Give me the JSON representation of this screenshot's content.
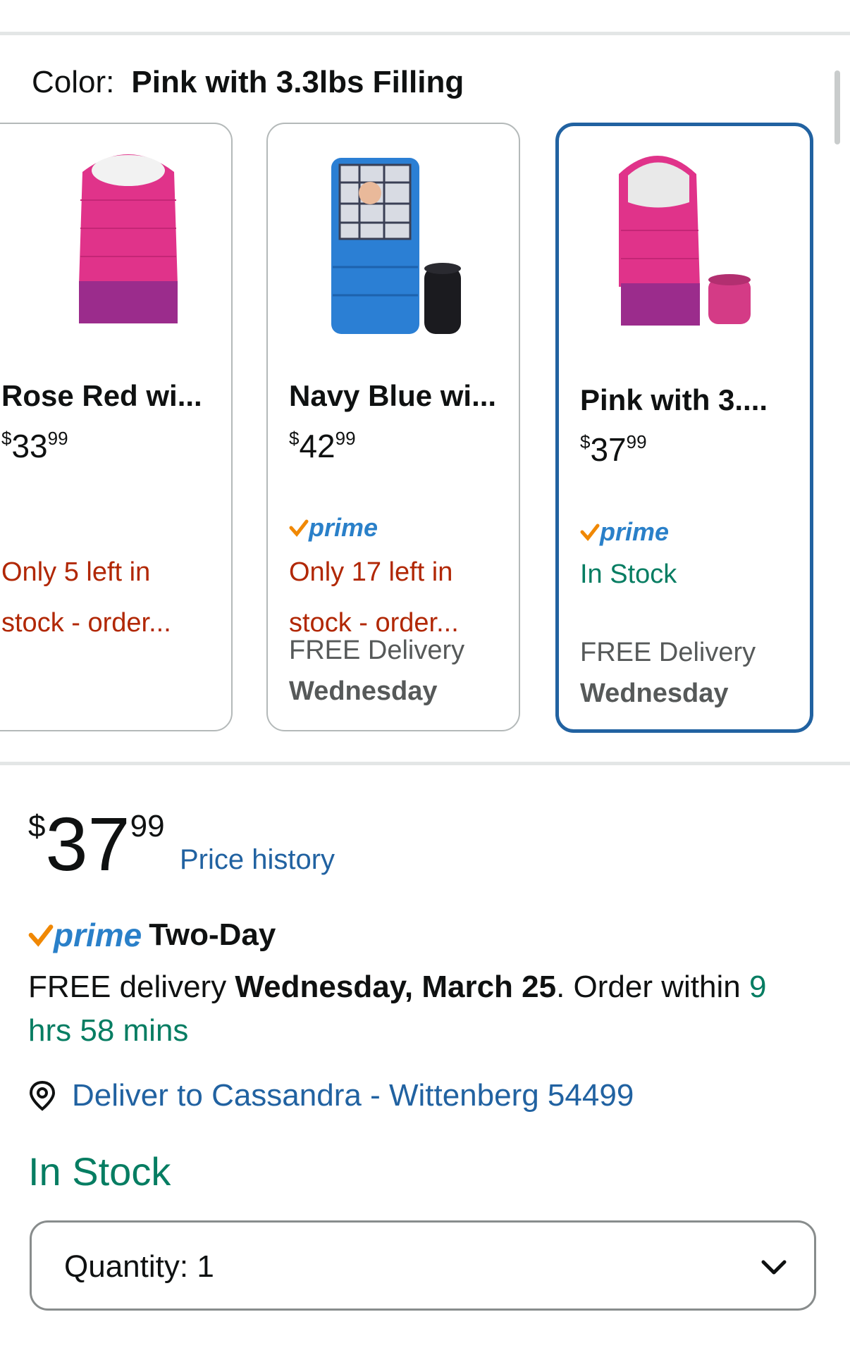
{
  "color": {
    "label": "Color:",
    "value": "Pink with 3.3lbs Filling"
  },
  "swatches": [
    {
      "name": "Rose Red wi...",
      "price_symbol": "$",
      "price_whole": "33",
      "price_fraction": "99",
      "stock_line1": "Only 5 left in",
      "stock_line2": "stock - order..."
    },
    {
      "name": "Navy Blue wi...",
      "price_symbol": "$",
      "price_whole": "42",
      "price_fraction": "99",
      "prime": "prime",
      "stock_line1": "Only 17 left in",
      "stock_line2": "stock - order...",
      "delivery": "FREE Delivery",
      "delivery_day": "Wednesday"
    },
    {
      "name": "Pink with 3....",
      "price_symbol": "$",
      "price_whole": "37",
      "price_fraction": "99",
      "prime": "prime",
      "stock": "In Stock",
      "delivery": "FREE Delivery",
      "delivery_day": "Wednesday",
      "selected": true
    }
  ],
  "buybox": {
    "price_symbol": "$",
    "price_whole": "37",
    "price_fraction": "99",
    "price_history": "Price history",
    "prime": "prime",
    "prime_service": "Two-Day",
    "delivery_prefix": "FREE delivery ",
    "delivery_date": "Wednesday, March 25",
    "delivery_middle": ". Order within ",
    "order_within": "9 hrs 58 mins",
    "deliver_to": "Deliver to Cassandra - Wittenberg 54499",
    "in_stock": "In Stock",
    "quantity_label": "Quantity:",
    "quantity_value": "1"
  },
  "colors": {
    "link": "#2162a1",
    "prime_blue": "#2a80c9",
    "prime_check": "#f08804",
    "stock_red": "#b12704",
    "stock_green": "#067d62",
    "selected_border": "#2162a1",
    "pink_bag": "#e0338a",
    "purple_bag": "#9b2c8c",
    "blue_bag": "#2b7fd4"
  },
  "icons": {
    "prime_check": "checkmark-icon",
    "location": "location-pin-icon",
    "chevron": "chevron-down-icon"
  }
}
